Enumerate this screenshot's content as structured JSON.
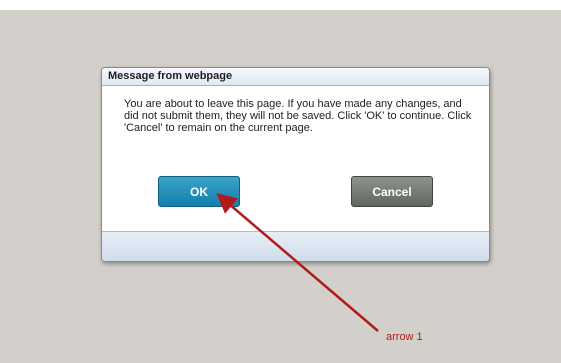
{
  "dialog": {
    "title": "Message from webpage",
    "message": "You are about to leave this page. If you have made any changes, and did not submit them, they will not be saved. Click 'OK' to continue. Click 'Cancel' to remain on the current page.",
    "ok_label": "OK",
    "cancel_label": "Cancel"
  },
  "annotation": {
    "label": "arrow 1",
    "color": "#b01a1a"
  },
  "colors": {
    "backdrop": "#d3d0cb",
    "ok_button": "#1a86b5",
    "cancel_button": "#6f776f"
  }
}
